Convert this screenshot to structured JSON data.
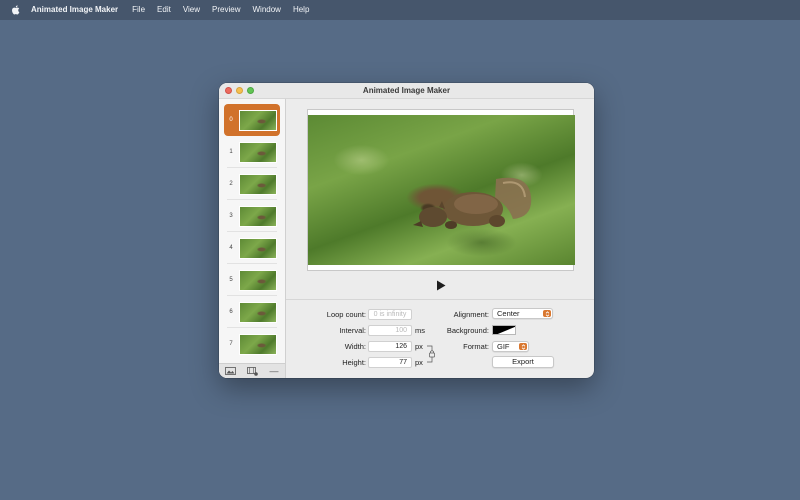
{
  "menubar": {
    "apple_icon": "apple-logo-icon",
    "app_name": "Animated Image Maker",
    "items": [
      "File",
      "Edit",
      "View",
      "Preview",
      "Window",
      "Help"
    ]
  },
  "window": {
    "title": "Animated Image Maker"
  },
  "sidebar": {
    "frames": [
      {
        "label": "0"
      },
      {
        "label": "1"
      },
      {
        "label": "2"
      },
      {
        "label": "3"
      },
      {
        "label": "4"
      },
      {
        "label": "5"
      },
      {
        "label": "6"
      },
      {
        "label": "7"
      }
    ],
    "selected_frame": "0",
    "toolbar": {
      "add_image_icon": "add-image-icon",
      "add_video_icon": "add-video-frames-icon",
      "remove_icon": "minus-icon",
      "remove_label": "—"
    }
  },
  "preview": {
    "play_icon": "play-icon"
  },
  "settings": {
    "loop_count": {
      "label": "Loop count:",
      "value": "",
      "placeholder": "0 is infinity"
    },
    "interval": {
      "label": "Interval:",
      "value": "",
      "placeholder": "100",
      "unit": "ms"
    },
    "width": {
      "label": "Width:",
      "value": "126",
      "unit": "px"
    },
    "height": {
      "label": "Height:",
      "value": "77",
      "unit": "px"
    },
    "alignment": {
      "label": "Alignment:",
      "value": "Center"
    },
    "background": {
      "label": "Background:"
    },
    "format": {
      "label": "Format:",
      "value": "GIF"
    },
    "export_label": "Export"
  },
  "colors": {
    "accent": "#d9772f",
    "selection": "#d1722b",
    "desktop": "#566b86",
    "menubar": "#46566c"
  }
}
